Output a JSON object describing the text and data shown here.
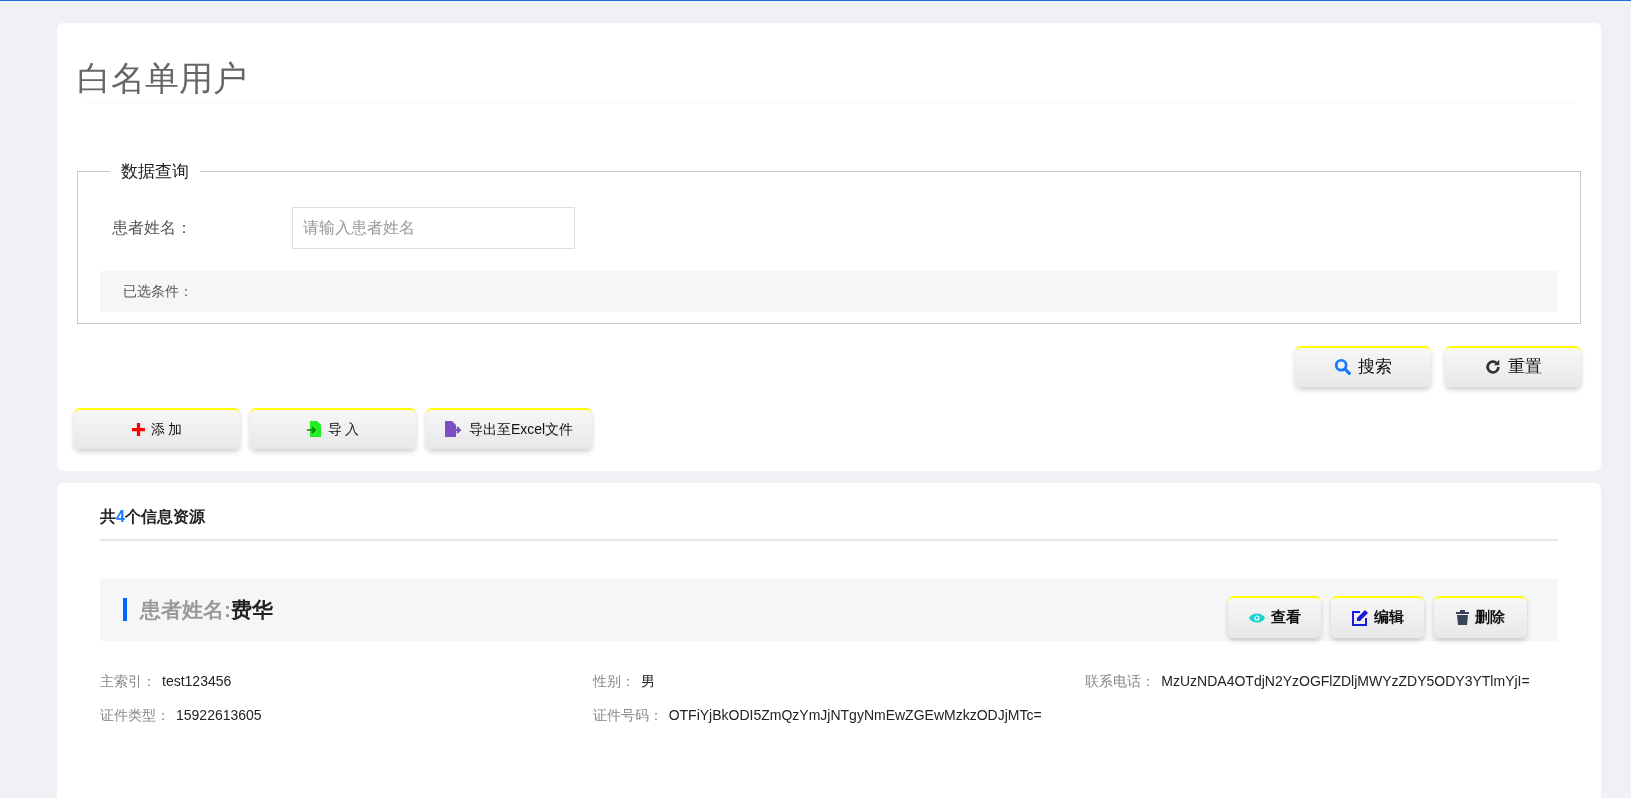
{
  "page": {
    "title": "白名单用户"
  },
  "query": {
    "legend": "数据查询",
    "fields": [
      {
        "label": "患者姓名：",
        "placeholder": "请输入患者姓名"
      }
    ],
    "selected_conditions_label": "已选条件："
  },
  "query_buttons": [
    {
      "kind": "search",
      "label": "搜索"
    },
    {
      "kind": "reset",
      "label": "重置"
    }
  ],
  "action_buttons": [
    {
      "kind": "add",
      "label": "添 加"
    },
    {
      "kind": "import",
      "label": "导 入"
    },
    {
      "kind": "export",
      "label": "导出至Excel文件"
    }
  ],
  "results": {
    "prefix": "共",
    "count": "4",
    "suffix": "个信息资源"
  },
  "records": [
    {
      "name_label": "患者姓名:",
      "name": "费华",
      "buttons": [
        {
          "kind": "view",
          "label": "查看"
        },
        {
          "kind": "edit",
          "label": "编辑"
        },
        {
          "kind": "delete",
          "label": "删除"
        }
      ],
      "fields": [
        {
          "label": "主索引：",
          "value": "test123456"
        },
        {
          "label": "性别：",
          "value": "男"
        },
        {
          "label": "联系电话：",
          "value": "MzUzNDA4OTdjN2YzOGFlZDljMWYzZDY5ODY3YTlmYjI="
        },
        {
          "label": "证件类型：",
          "value": "15922613605"
        },
        {
          "label": "证件号码：",
          "value": "OTFiYjBkODI5ZmQzYmJjNTgyNmEwZGEwMzkzODJjMTc="
        }
      ]
    }
  ]
}
